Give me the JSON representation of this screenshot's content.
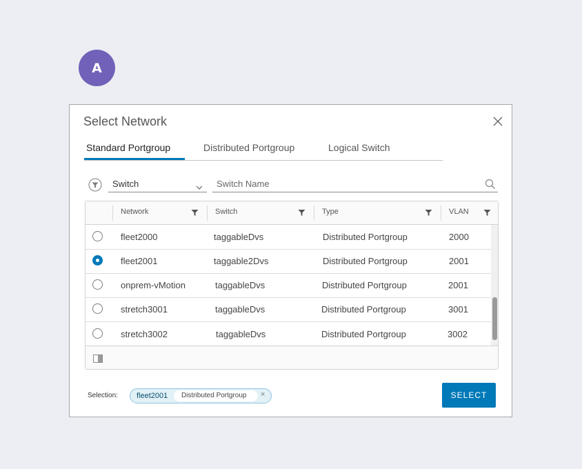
{
  "step_badge": "A",
  "dialog": {
    "title": "Select Network",
    "tabs": [
      {
        "label": "Standard Portgroup",
        "active": true
      },
      {
        "label": "Distributed Portgroup",
        "active": false
      },
      {
        "label": "Logical Switch",
        "active": false
      }
    ],
    "filter": {
      "dropdown_value": "Switch",
      "search_placeholder": "Switch Name",
      "search_value": ""
    },
    "grid": {
      "columns": [
        "Network",
        "Switch",
        "Type",
        "VLAN"
      ],
      "rows": [
        {
          "network": "fleet2000",
          "switch": "taggableDvs",
          "type": "Distributed Portgroup",
          "vlan": "2000",
          "selected": false
        },
        {
          "network": "fleet2001",
          "switch": "taggable2Dvs",
          "type": "Distributed Portgroup",
          "vlan": "2001",
          "selected": true
        },
        {
          "network": "onprem-vMotion",
          "switch": "taggableDvs",
          "type": "Distributed Portgroup",
          "vlan": "2001",
          "selected": false
        },
        {
          "network": "stretch3001",
          "switch": "taggableDvs",
          "type": "Distributed Portgroup",
          "vlan": "3001",
          "selected": false
        },
        {
          "network": "stretch3002",
          "switch": "taggableDvs",
          "type": "Distributed Portgroup",
          "vlan": "3002",
          "selected": false
        }
      ]
    },
    "selection": {
      "label": "Selection:",
      "chip_name": "fleet2001",
      "chip_type": "Distributed Portgroup",
      "chip_remove": "×"
    },
    "select_button": "SELECT"
  },
  "colors": {
    "accent": "#0079b8",
    "badge": "#7161b8",
    "background": "#eceef3"
  },
  "icons": [
    "close-icon",
    "filter-icon",
    "chevron-down-icon",
    "search-icon",
    "column-toggle-icon"
  ]
}
